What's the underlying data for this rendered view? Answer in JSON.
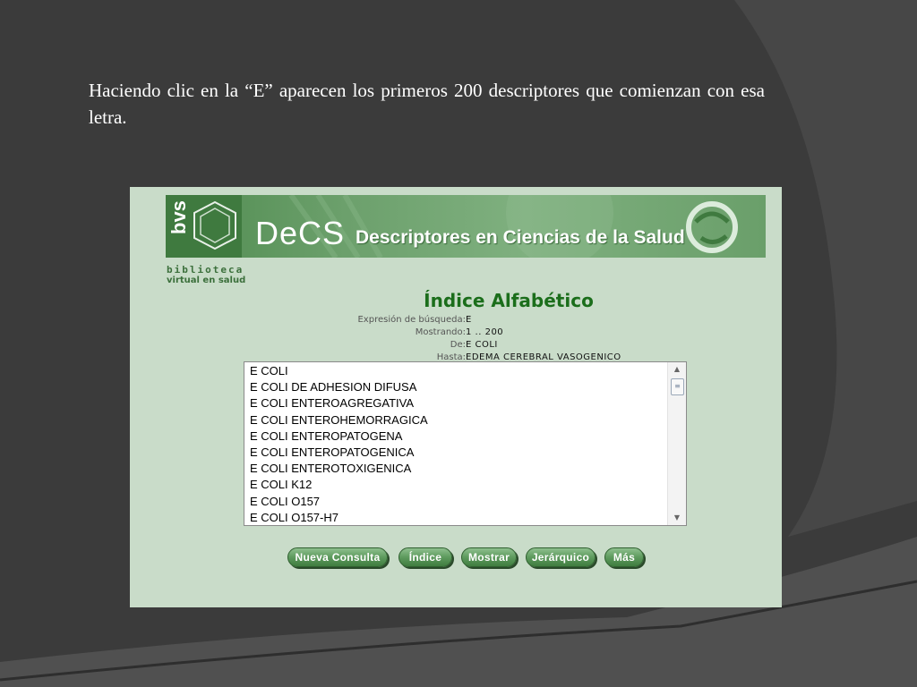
{
  "slide": {
    "text": "Haciendo clic en la “E” aparecen los primeros 200 descriptores que comienzan con esa letra."
  },
  "banner": {
    "logo_text": "bvs",
    "decs": "DeCS",
    "title": "Descriptores en Ciencias de la Salud",
    "bib_line1": "biblioteca",
    "bib_line2": "virtual en salud"
  },
  "page": {
    "title": "Índice Alfabético"
  },
  "meta": [
    {
      "label": "Expresión de búsqueda:",
      "value": "E"
    },
    {
      "label": "Mostrando:",
      "value": "1 .. 200"
    },
    {
      "label": "De:",
      "value": "E COLI"
    },
    {
      "label": "Hasta:",
      "value": "EDEMA CEREBRAL VASOGENICO"
    }
  ],
  "list": [
    "E COLI",
    "E COLI DE ADHESION DIFUSA",
    "E COLI ENTEROAGREGATIVA",
    "E COLI ENTEROHEMORRAGICA",
    "E COLI ENTEROPATOGENA",
    "E COLI ENTEROPATOGENICA",
    "E COLI ENTEROTOXIGENICA",
    "E COLI K12",
    "E COLI O157",
    "E COLI O157-H7"
  ],
  "buttons": {
    "nueva": "Nueva Consulta",
    "indice": "Índice",
    "mostrar": "Mostrar",
    "jerarquico": "Jerárquico",
    "mas": "Más"
  },
  "icons": {
    "scroll_up": "scroll-up-arrow",
    "scroll_down": "scroll-down-arrow"
  },
  "colors": {
    "slide_bg": "#3b3b3b",
    "panel_bg": "#c9dcc9",
    "title_green": "#1b6e1b"
  }
}
